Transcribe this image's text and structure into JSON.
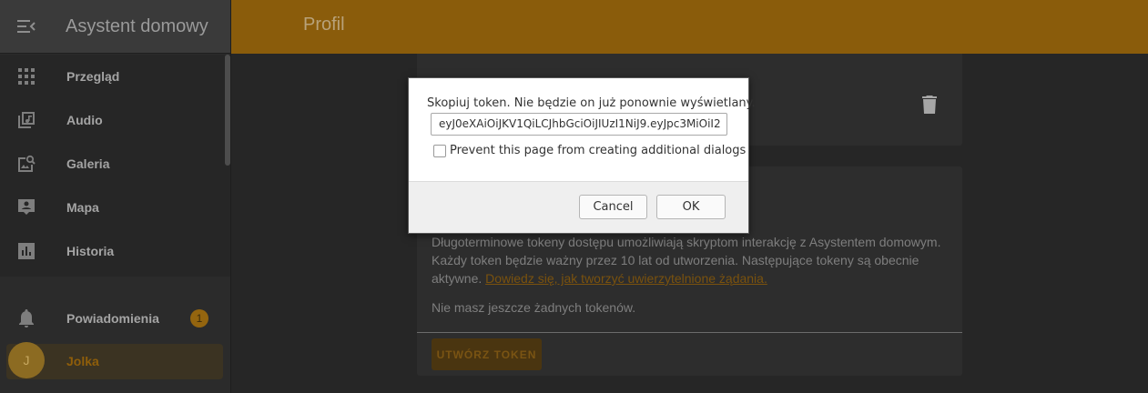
{
  "sidebar": {
    "title": "Asystent domowy",
    "items": [
      {
        "label": "Przegląd",
        "icon": "grid-icon"
      },
      {
        "label": "Audio",
        "icon": "music-library-icon"
      },
      {
        "label": "Galeria",
        "icon": "image-search-icon"
      },
      {
        "label": "Mapa",
        "icon": "account-box-icon"
      },
      {
        "label": "Historia",
        "icon": "bar-chart-icon"
      }
    ],
    "notifications": {
      "label": "Powiadomienia",
      "count": "1",
      "icon": "bell-icon"
    },
    "user": {
      "initial": "J",
      "name": "Jolka"
    }
  },
  "topbar": {
    "title": "Profil"
  },
  "tokens_card": {
    "description": "Długoterminowe tokeny dostępu umożliwiają skryptom interakcję z Asystentem domowym. Każdy token będzie ważny przez 10 lat od utworzenia. Następujące tokeny są obecnie aktywne.",
    "link_text": "Dowiedz się, jak tworzyć uwierzytelnione żądania.",
    "empty_text": "Nie masz jeszcze żadnych tokenów.",
    "create_button": "UTWÓRZ TOKEN"
  },
  "dialog": {
    "message": "Skopiuj token. Nie będzie on już ponownie wyświetlany.",
    "token_value": "eyJ0eXAiOiJKV1QiLCJhbGciOiJIUzI1NiJ9.eyJpc3MiOiI2",
    "checkbox_label": "Prevent this page from creating additional dialogs",
    "cancel_label": "Cancel",
    "ok_label": "OK"
  },
  "colors": {
    "accent": "#8a5c0b",
    "sidebar_bg": "#2b2b2b",
    "page_bg": "#262626",
    "card_bg": "#2d2d2d"
  }
}
